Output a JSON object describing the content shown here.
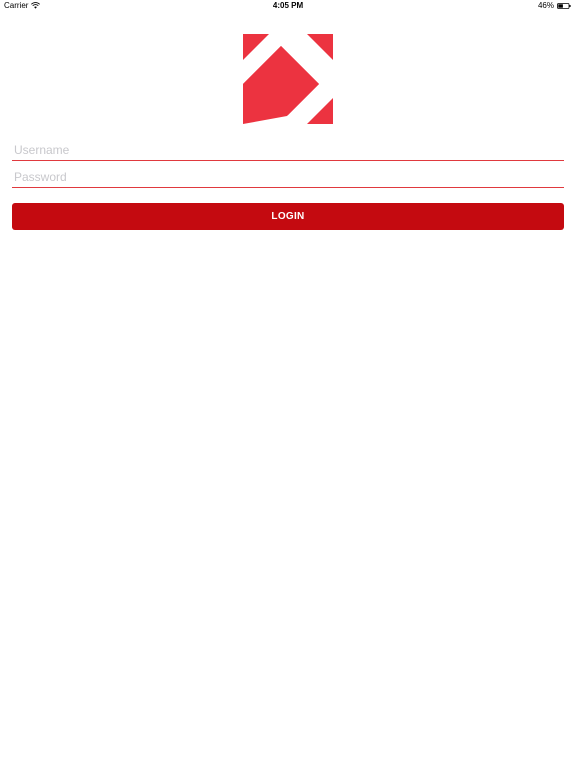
{
  "status_bar": {
    "carrier": "Carrier",
    "time": "4:05 PM",
    "battery_percent": "46%",
    "battery_level": 0.46,
    "wifi_icon": "wifi-icon",
    "battery_icon": "battery-icon"
  },
  "logo": {
    "icon": "brand-logo",
    "color": "#ec3340"
  },
  "form": {
    "username_placeholder": "Username",
    "username_value": "",
    "password_placeholder": "Password",
    "password_value": "",
    "field_underline_color": "#e0393e",
    "login_label": "LOGIN",
    "button_color": "#c40a10"
  }
}
